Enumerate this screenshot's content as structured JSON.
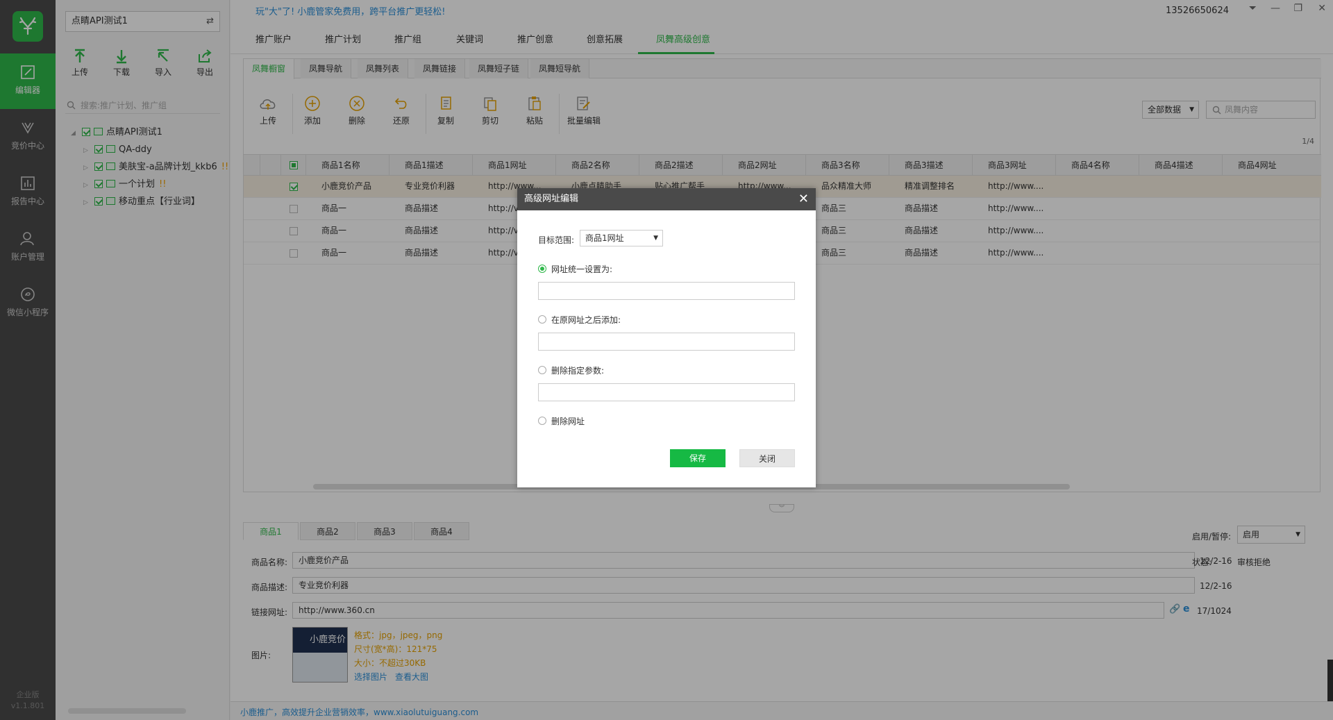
{
  "rail": {
    "items": [
      {
        "label": "编辑器",
        "icon": "edit-icon"
      },
      {
        "label": "竞价中心",
        "icon": "bid-icon"
      },
      {
        "label": "报告中心",
        "icon": "report-icon"
      },
      {
        "label": "账户管理",
        "icon": "user-icon"
      },
      {
        "label": "微信小程序",
        "icon": "miniprogram-icon"
      }
    ],
    "edition": "企业版",
    "version": "v1.1.801"
  },
  "tree": {
    "account": "点睛API测试1",
    "toolbar": [
      "上传",
      "下载",
      "导入",
      "导出"
    ],
    "search_placeholder": "搜索:推广计划、推广组",
    "root": "点睛API测试1",
    "plans": [
      {
        "name": "QA-ddy",
        "warn": ""
      },
      {
        "name": "美肤宝-a品牌计划_kkb6",
        "warn": "!!"
      },
      {
        "name": "一个计划",
        "warn": "!!"
      },
      {
        "name": "移动重点【行业词】",
        "warn": ""
      }
    ]
  },
  "header": {
    "promo": "玩\"大\"了! 小鹿管家免费用，跨平台推广更轻松!",
    "phone": "13526650624",
    "tabs": [
      "推广账户",
      "推广计划",
      "推广组",
      "关键词",
      "推广创意",
      "创意拓展",
      "凤舞高级创意"
    ],
    "active_tab": 6
  },
  "subtabs": [
    "凤舞橱窗",
    "凤舞导航",
    "凤舞列表",
    "凤舞链接",
    "凤舞短子链",
    "凤舞短导航"
  ],
  "tools": [
    "上传",
    "添加",
    "删除",
    "还原",
    "复制",
    "剪切",
    "粘贴",
    "批量编辑"
  ],
  "filter": {
    "scope": "全部数据",
    "search_placeholder": "凤舞内容"
  },
  "pager": "1/4",
  "grid": {
    "columns": [
      "商品1名称",
      "商品1描述",
      "商品1网址",
      "商品2名称",
      "商品2描述",
      "商品2网址",
      "商品3名称",
      "商品3描述",
      "商品3网址",
      "商品4名称",
      "商品4描述",
      "商品4网址"
    ],
    "rows": [
      {
        "checked": true,
        "cells": [
          "小鹿竞价产品",
          "专业竞价利器",
          "http://www...",
          "小鹿点睛助手",
          "贴心推广帮手",
          "http://www...",
          "品众精准大师",
          "精准调整排名",
          "http://www...."
        ]
      },
      {
        "checked": false,
        "cells": [
          "商品一",
          "商品描述",
          "http://v",
          "",
          "",
          "",
          "商品三",
          "商品描述",
          "http://www...."
        ]
      },
      {
        "checked": false,
        "cells": [
          "商品一",
          "商品描述",
          "http://v",
          "",
          "",
          "",
          "商品三",
          "商品描述",
          "http://www...."
        ]
      },
      {
        "checked": false,
        "cells": [
          "商品一",
          "商品描述",
          "http://v",
          "",
          "",
          "",
          "商品三",
          "商品描述",
          "http://www...."
        ]
      }
    ]
  },
  "editor": {
    "tabs": [
      "商品1",
      "商品2",
      "商品3",
      "商品4"
    ],
    "name_label": "商品名称:",
    "name_value": "小鹿竞价产品",
    "name_count": "12/2-16",
    "desc_label": "商品描述:",
    "desc_value": "专业竞价利器",
    "desc_count": "12/2-16",
    "url_label": "链接网址:",
    "url_value": "http://www.360.cn",
    "url_count": "17/1024",
    "image_label": "图片:",
    "image_text": "小鹿竞价",
    "image_info": [
      "格式：jpg，jpeg，png",
      "尺寸(宽*高)：121*75",
      "大小：不超过30KB"
    ],
    "select_image": "选择图片",
    "view_image": "查看大图",
    "status_toggle_label": "启用/暂停:",
    "status_toggle_value": "启用",
    "status_label": "状态:",
    "status_value": "审核拒绝"
  },
  "footer": "小鹿推广，高效提升企业营销效率，www.xiaolutuiguang.com",
  "dialog": {
    "title": "高级网址编辑",
    "scope_label": "目标范围:",
    "scope_value": "商品1网址",
    "options": [
      "网址统一设置为:",
      "在原网址之后添加:",
      "删除指定参数:",
      "删除网址"
    ],
    "selected_option": 0,
    "save": "保存",
    "close": "关闭"
  },
  "colors": {
    "accent": "#2fb84a",
    "rail": "#4a4a4a",
    "link": "#2b8fd9",
    "warn": "#e6a100"
  }
}
